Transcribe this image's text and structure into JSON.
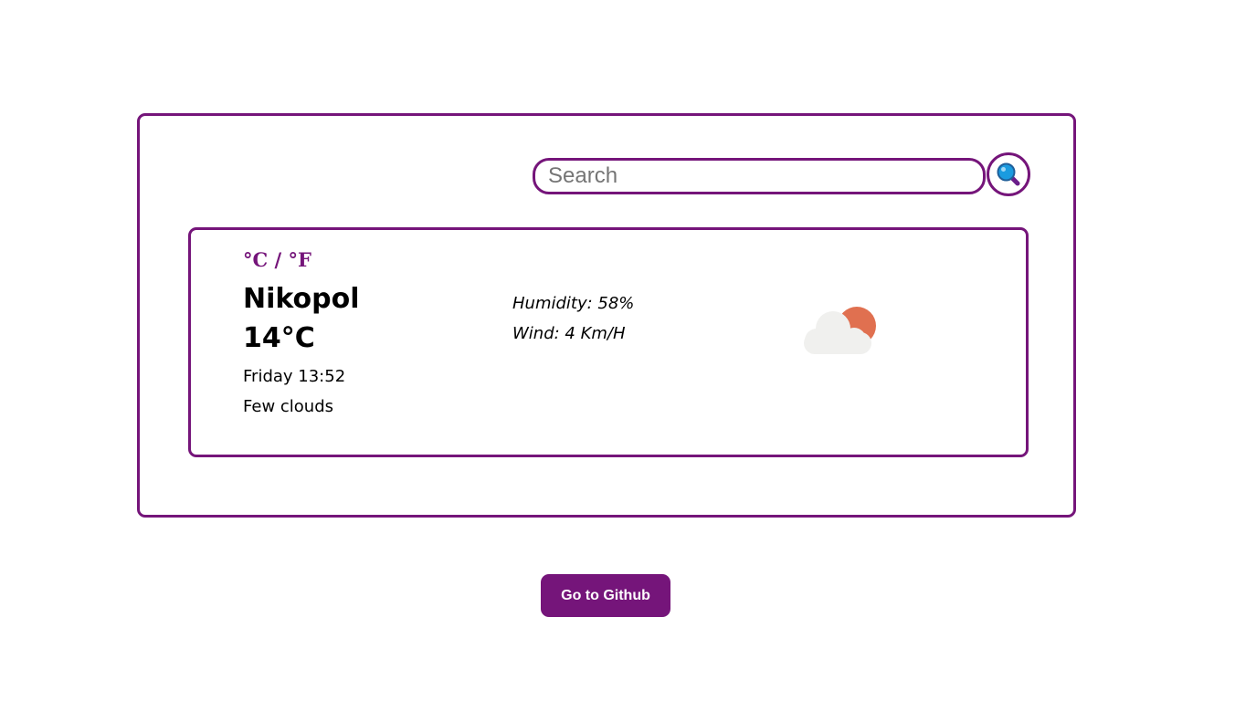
{
  "search": {
    "placeholder": "Search",
    "value": ""
  },
  "search_button": {
    "icon": "magnifying-glass-icon"
  },
  "weather": {
    "unit_toggle": "°C / °F",
    "city": "Nikopol",
    "temperature": "14°C",
    "date_time": "Friday 13:52",
    "description": "Few clouds",
    "humidity": "Humidity: 58%",
    "wind": "Wind: 4 Km/H",
    "icon": "few-clouds-icon"
  },
  "footer": {
    "github_label": "Go to Github"
  },
  "colors": {
    "accent": "#75157a",
    "sun": "#e07050",
    "cloud": "#f0f0ee",
    "search_icon_lens": "#1a9be0"
  }
}
